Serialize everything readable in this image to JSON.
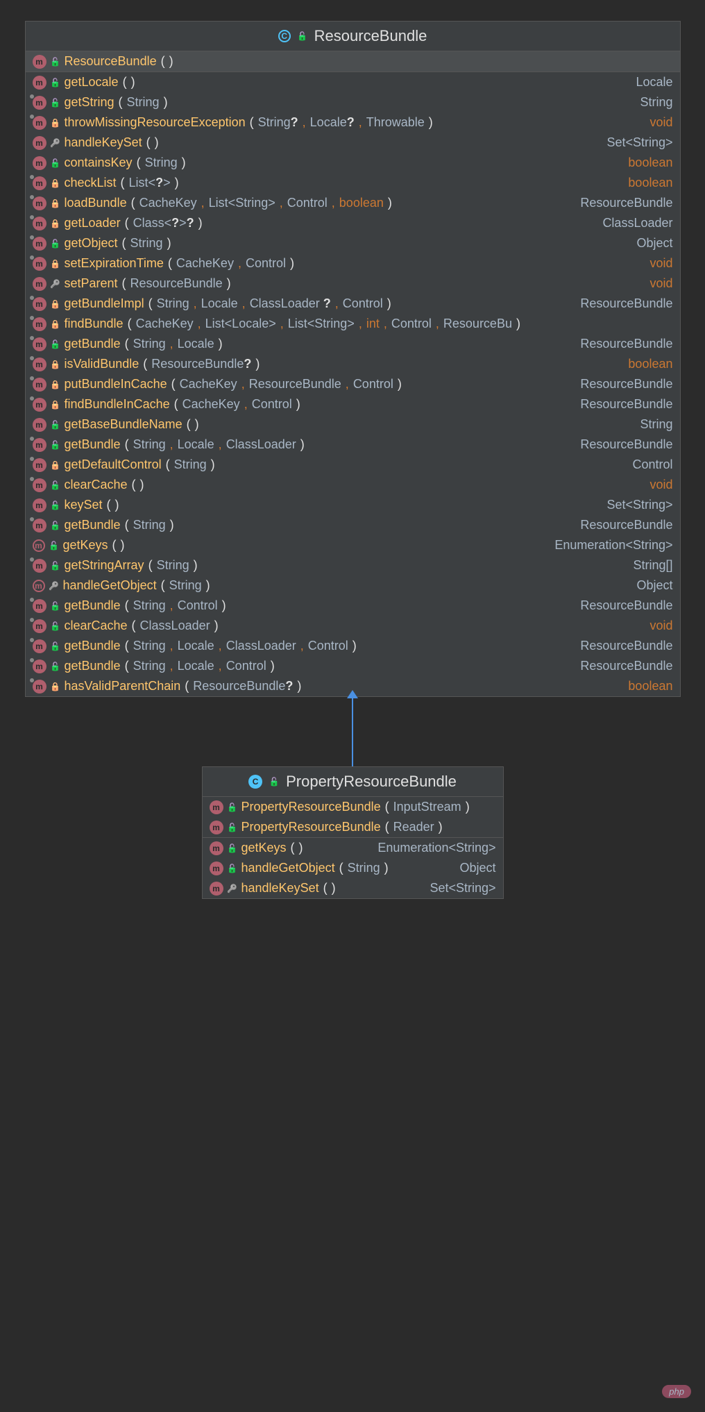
{
  "watermark": "php",
  "classes": [
    {
      "name": "ResourceBundle",
      "abstract": true,
      "sections": [
        [
          {
            "kind": "m",
            "vis": "public",
            "name": "ResourceBundle",
            "params": [],
            "ret": null
          }
        ],
        [
          {
            "kind": "m",
            "vis": "public",
            "name": "getLocale",
            "params": [],
            "ret": "Locale"
          },
          {
            "kind": "m",
            "vis": "public",
            "static": true,
            "name": "getString",
            "params": [
              "String"
            ],
            "ret": "String"
          },
          {
            "kind": "m",
            "vis": "private",
            "static": true,
            "name": "throwMissingResourceException",
            "params": [
              "String?",
              "Locale?",
              "Throwable"
            ],
            "ret": "void",
            "space": true
          },
          {
            "kind": "m",
            "vis": "protected",
            "name": "handleKeySet",
            "params": [],
            "ret": "Set<String>"
          },
          {
            "kind": "m",
            "vis": "public",
            "name": "containsKey",
            "params": [
              "String"
            ],
            "ret": "boolean"
          },
          {
            "kind": "m",
            "vis": "private",
            "static": true,
            "name": "checkList",
            "params": [
              "List<?>"
            ],
            "ret": "boolean"
          },
          {
            "kind": "m",
            "vis": "private",
            "static": true,
            "name": "loadBundle",
            "params": [
              "CacheKey",
              "List<String>",
              "Control",
              "boolean"
            ],
            "ret": "ResourceBundle",
            "space": true
          },
          {
            "kind": "m",
            "vis": "private",
            "static": true,
            "name": "getLoader",
            "params": [
              "Class<?>?"
            ],
            "ret": "ClassLoader",
            "space": true
          },
          {
            "kind": "m",
            "vis": "public",
            "static": true,
            "name": "getObject",
            "params": [
              "String"
            ],
            "ret": "Object"
          },
          {
            "kind": "m",
            "vis": "private",
            "static": true,
            "name": "setExpirationTime",
            "params": [
              "CacheKey",
              "Control"
            ],
            "ret": "void",
            "space": true
          },
          {
            "kind": "m",
            "vis": "protected",
            "name": "setParent",
            "params": [
              "ResourceBundle"
            ],
            "ret": "void"
          },
          {
            "kind": "m",
            "vis": "private",
            "static": true,
            "name": "getBundleImpl",
            "params": [
              "String",
              "Locale",
              "ClassLoader ?",
              "Control"
            ],
            "ret": "ResourceBundle",
            "space": true
          },
          {
            "kind": "m",
            "vis": "private",
            "static": true,
            "name": "findBundle",
            "params": [
              "CacheKey",
              "List<Locale>",
              "List<String>",
              "int",
              "Control",
              "ResourceBu"
            ],
            "ret": "",
            "space": false
          },
          {
            "kind": "m",
            "vis": "public",
            "static": true,
            "name": "getBundle",
            "params": [
              "String",
              "Locale"
            ],
            "ret": "ResourceBundle"
          },
          {
            "kind": "m",
            "vis": "private",
            "static": true,
            "name": "isValidBundle",
            "params": [
              "ResourceBundle?"
            ],
            "ret": "boolean",
            "space": true
          },
          {
            "kind": "m",
            "vis": "private",
            "static": true,
            "name": "putBundleInCache",
            "params": [
              "CacheKey",
              "ResourceBundle",
              "Control"
            ],
            "ret": "ResourceBundle"
          },
          {
            "kind": "m",
            "vis": "private",
            "static": true,
            "name": "findBundleInCache",
            "params": [
              "CacheKey",
              "Control"
            ],
            "ret": "ResourceBundle"
          },
          {
            "kind": "m",
            "vis": "public",
            "name": "getBaseBundleName",
            "params": [],
            "ret": "String",
            "space": true
          },
          {
            "kind": "m",
            "vis": "public",
            "static": true,
            "name": "getBundle",
            "params": [
              "String",
              "Locale",
              "ClassLoader "
            ],
            "ret": "ResourceBundle"
          },
          {
            "kind": "m",
            "vis": "private",
            "static": true,
            "name": "getDefaultControl",
            "params": [
              "String"
            ],
            "ret": "Control"
          },
          {
            "kind": "m",
            "vis": "public",
            "static": true,
            "name": "clearCache",
            "params": [],
            "ret": "void",
            "space": true
          },
          {
            "kind": "m",
            "vis": "public",
            "name": "keySet",
            "params": [],
            "ret": "Set<String>"
          },
          {
            "kind": "m",
            "vis": "public",
            "static": true,
            "name": "getBundle",
            "params": [
              "String"
            ],
            "ret": "ResourceBundle"
          },
          {
            "kind": "m",
            "vis": "public",
            "abstract": true,
            "name": "getKeys",
            "params": [],
            "ret": "Enumeration<String>"
          },
          {
            "kind": "m",
            "vis": "public",
            "static": true,
            "name": "getStringArray",
            "params": [
              "String"
            ],
            "ret": "String[]"
          },
          {
            "kind": "m",
            "vis": "protected",
            "abstract": true,
            "name": "handleGetObject",
            "params": [
              "String"
            ],
            "ret": "Object"
          },
          {
            "kind": "m",
            "vis": "public",
            "static": true,
            "name": "getBundle",
            "params": [
              "String",
              "Control"
            ],
            "ret": "ResourceBundle"
          },
          {
            "kind": "m",
            "vis": "public",
            "static": true,
            "name": "clearCache",
            "params": [
              "ClassLoader "
            ],
            "ret": "void",
            "space": true
          },
          {
            "kind": "m",
            "vis": "public",
            "static": true,
            "name": "getBundle",
            "params": [
              "String",
              "Locale",
              "ClassLoader ",
              "Control"
            ],
            "ret": "ResourceBundle"
          },
          {
            "kind": "m",
            "vis": "public",
            "static": true,
            "name": "getBundle",
            "params": [
              "String",
              "Locale",
              "Control"
            ],
            "ret": "ResourceBundle"
          },
          {
            "kind": "m",
            "vis": "private",
            "static": true,
            "name": "hasValidParentChain",
            "params": [
              "ResourceBundle?"
            ],
            "ret": "boolean",
            "space": true
          }
        ]
      ]
    },
    {
      "name": "PropertyResourceBundle",
      "abstract": false,
      "sections": [
        [
          {
            "kind": "m",
            "vis": "public",
            "name": "PropertyResourceBundle",
            "params": [
              "InputStream"
            ],
            "ret": null,
            "space": true
          },
          {
            "kind": "m",
            "vis": "public",
            "name": "PropertyResourceBundle",
            "params": [
              "Reader"
            ],
            "ret": null,
            "space": true
          }
        ],
        [
          {
            "kind": "m",
            "vis": "public",
            "name": "getKeys",
            "params": [],
            "ret": "Enumeration<String>"
          },
          {
            "kind": "m",
            "vis": "public",
            "name": "handleGetObject",
            "params": [
              "String"
            ],
            "ret": "Object"
          },
          {
            "kind": "m",
            "vis": "protected",
            "name": "handleKeySet",
            "params": [],
            "ret": "Set<String>"
          }
        ]
      ]
    }
  ]
}
